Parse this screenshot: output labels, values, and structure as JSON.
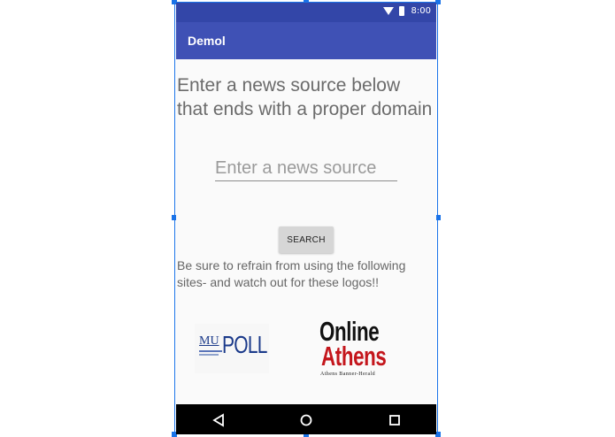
{
  "status_bar": {
    "time": "8:00",
    "wifi_icon": "wifi-icon",
    "battery_icon": "battery-icon"
  },
  "app_bar": {
    "title": "Demol"
  },
  "main": {
    "heading": "Enter a news source below that ends with a proper domain",
    "search_input": {
      "placeholder": "Enter a news source",
      "value": ""
    },
    "search_button": "SEARCH",
    "warning": "Be sure to refrain from using the following sites- and watch out for these logos!!"
  },
  "logos": {
    "mu_poll": {
      "mu": "MU",
      "poll": "POLL"
    },
    "online_athens": {
      "line1": "Online",
      "line2": "Athens",
      "tagline": "Athens Banner-Herald"
    }
  },
  "nav": {
    "back_icon": "back-triangle-icon",
    "home_icon": "home-circle-icon",
    "recent_icon": "recents-square-icon"
  },
  "colors": {
    "primary": "#3f51b5",
    "primary_dark": "#3346a8",
    "accent_red": "#c4161c",
    "selection": "#1a73e8"
  }
}
